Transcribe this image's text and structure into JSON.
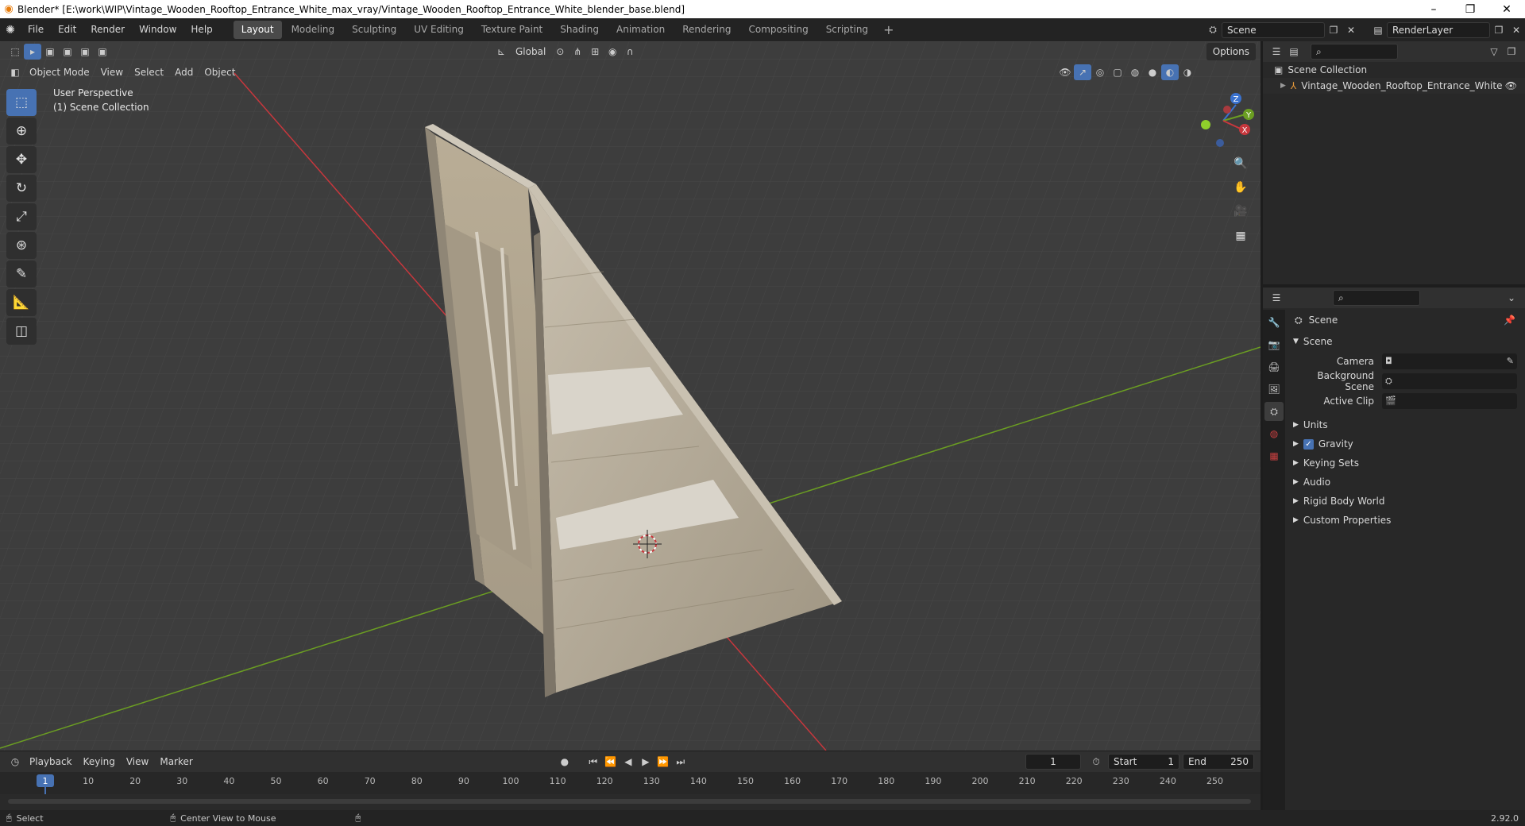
{
  "window": {
    "title": "Blender* [E:\\work\\WIP\\Vintage_Wooden_Rooftop_Entrance_White_max_vray/Vintage_Wooden_Rooftop_Entrance_White_blender_base.blend]",
    "minimize": "–",
    "maximize": "❐",
    "close": "✕"
  },
  "menu": [
    "File",
    "Edit",
    "Render",
    "Window",
    "Help"
  ],
  "workspaces": [
    "Layout",
    "Modeling",
    "Sculpting",
    "UV Editing",
    "Texture Paint",
    "Shading",
    "Animation",
    "Rendering",
    "Compositing",
    "Scripting"
  ],
  "active_workspace": "Layout",
  "scene_field": "Scene",
  "renderlayer_field": "RenderLayer",
  "viewport": {
    "mode": "Object Mode",
    "menus": [
      "View",
      "Select",
      "Add",
      "Object"
    ],
    "transform_orientation": "Global",
    "options": "Options",
    "info_line1": "User Perspective",
    "info_line2": "(1) Scene Collection",
    "gizmo": {
      "x": "X",
      "y": "Y",
      "z": "Z"
    }
  },
  "tools": [
    "select-box",
    "cursor",
    "move",
    "rotate",
    "scale",
    "transform",
    "annotate",
    "measure",
    "add-cube"
  ],
  "outliner": {
    "root": "Scene Collection",
    "items": [
      "Vintage_Wooden_Rooftop_Entrance_White"
    ]
  },
  "properties": {
    "context": "Scene",
    "panel_title": "Scene",
    "fields": [
      {
        "label": "Camera",
        "value": ""
      },
      {
        "label": "Background Scene",
        "value": ""
      },
      {
        "label": "Active Clip",
        "value": ""
      }
    ],
    "subpanels": [
      "Units",
      "Gravity",
      "Keying Sets",
      "Audio",
      "Rigid Body World",
      "Custom Properties"
    ],
    "gravity_checked": true
  },
  "timeline": {
    "menus": [
      "Playback",
      "Keying",
      "View",
      "Marker"
    ],
    "current_frame": "1",
    "start_label": "Start",
    "start": "1",
    "end_label": "End",
    "end": "250",
    "ruler": [
      "1",
      "10",
      "20",
      "30",
      "40",
      "50",
      "60",
      "70",
      "80",
      "90",
      "100",
      "110",
      "120",
      "130",
      "140",
      "150",
      "160",
      "170",
      "180",
      "190",
      "200",
      "210",
      "220",
      "230",
      "240",
      "250"
    ]
  },
  "status": {
    "select": "Select",
    "center_view": "Center View to Mouse",
    "version": "2.92.0"
  },
  "colors": {
    "accent": "#4772b3",
    "x_axis": "#c8373d",
    "y_axis": "#6b9e22",
    "z_axis": "#3a72cf",
    "viewport_bg": "#3d3d3d"
  }
}
